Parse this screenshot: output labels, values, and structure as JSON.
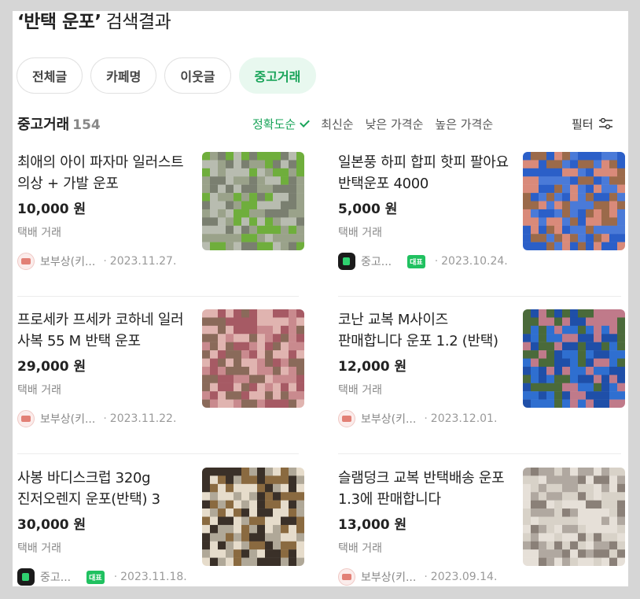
{
  "search": {
    "keyword": "‘반택 운포’",
    "suffix": "검색결과"
  },
  "tabs": [
    {
      "label": "전체글",
      "active": false
    },
    {
      "label": "카페명",
      "active": false
    },
    {
      "label": "이웃글",
      "active": false
    },
    {
      "label": "중고거래",
      "active": true
    }
  ],
  "section": {
    "title": "중고거래",
    "count": "154",
    "sorts": [
      {
        "label": "정확도순",
        "active": true
      },
      {
        "label": "최신순",
        "active": false
      },
      {
        "label": "낮은 가격순",
        "active": false
      },
      {
        "label": "높은 가격순",
        "active": false
      }
    ],
    "filter_label": "필터"
  },
  "items": [
    {
      "name": "최애의 아이 파자마 일러스트 의상 + 가발 운포",
      "price": "10,000 원",
      "delivery": "택배 거래",
      "cafe": "보부상(키...",
      "badge": "",
      "date": "2023.11.27.",
      "avatar": "pink",
      "thumb_colors": [
        "#9aa28a",
        "#6fae3c",
        "#b8bcb0",
        "#7a7f70"
      ]
    },
    {
      "name": "일본풍 하피 합피 핫피 팔아요 반택운포 4000",
      "price": "5,000 원",
      "delivery": "택배 거래",
      "cafe": "중고...",
      "badge": "대표",
      "date": "2023.10.24.",
      "avatar": "green",
      "thumb_colors": [
        "#2b5fc8",
        "#9b6a4a",
        "#d98a7a",
        "#4a7ad8"
      ]
    },
    {
      "name": "프로세카 프세카 코하네 일러 사복 55 M 반택 운포",
      "price": "29,000 원",
      "delivery": "택배 거래",
      "cafe": "보부상(키...",
      "badge": "",
      "date": "2023.11.22.",
      "avatar": "pink",
      "thumb_colors": [
        "#c98a8e",
        "#8a6a5a",
        "#e0b4b0",
        "#a65a64"
      ]
    },
    {
      "name": "코난 교복 M사이즈 판매합니다 운포 1.2 (반택)",
      "price": "12,000 원",
      "delivery": "택배 거래",
      "cafe": "보부상(키...",
      "badge": "",
      "date": "2023.12.01.",
      "avatar": "pink",
      "thumb_colors": [
        "#2f6fd0",
        "#4a6a3a",
        "#c07a8a",
        "#1f4fa8"
      ]
    },
    {
      "name": "사봉 바디스크럽 320g 진저오렌지 운포(반택) 3",
      "price": "30,000 원",
      "delivery": "택배 거래",
      "cafe": "중고...",
      "badge": "대표",
      "date": "2023.11.18.",
      "avatar": "green",
      "thumb_colors": [
        "#3a3028",
        "#e6dccb",
        "#8a6a40",
        "#b0a898"
      ]
    },
    {
      "name": "슬램덩크 교복 반택배송 운포 1.3에 판매합니다",
      "price": "13,000 원",
      "delivery": "택배 거래",
      "cafe": "보부상(키...",
      "badge": "",
      "date": "2023.09.14.",
      "avatar": "pink",
      "thumb_colors": [
        "#d8d2c8",
        "#8a8078",
        "#b0a8a0",
        "#e6e0d8"
      ]
    }
  ],
  "colors": {
    "accent": "#1aa45a",
    "badge": "#20c160"
  }
}
